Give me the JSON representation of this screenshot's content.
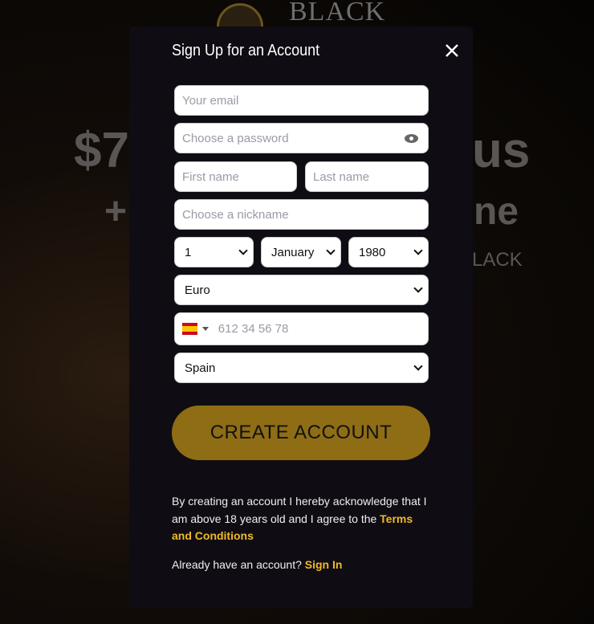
{
  "background": {
    "logo_text": "BLACK",
    "headline_left": "$7",
    "headline_right": "us",
    "line2_left": "+",
    "line2_right": "ne",
    "line3_right": "LACK"
  },
  "modal": {
    "title": "Sign Up for an Account",
    "close_icon": "close-icon",
    "email_placeholder": "Your email",
    "password_placeholder": "Choose a password",
    "first_name_placeholder": "First name",
    "last_name_placeholder": "Last name",
    "nickname_placeholder": "Choose a nickname",
    "birth_day": "1",
    "birth_month": "January",
    "birth_year": "1980",
    "currency": "Euro",
    "phone_placeholder": "612 34 56 78",
    "phone_country_flag": "spain-flag",
    "country": "Spain",
    "create_button": "CREATE ACCOUNT",
    "legal_text": "By creating an account I hereby acknowledge that I am above 18 years old and I agree to the ",
    "terms_link": "Terms and Conditions",
    "have_account": "Already have an account? ",
    "sign_in_link": "Sign In"
  },
  "colors": {
    "accent": "#f0b92a",
    "button": "#8f6d14",
    "modal_bg": "#0f0d13"
  }
}
